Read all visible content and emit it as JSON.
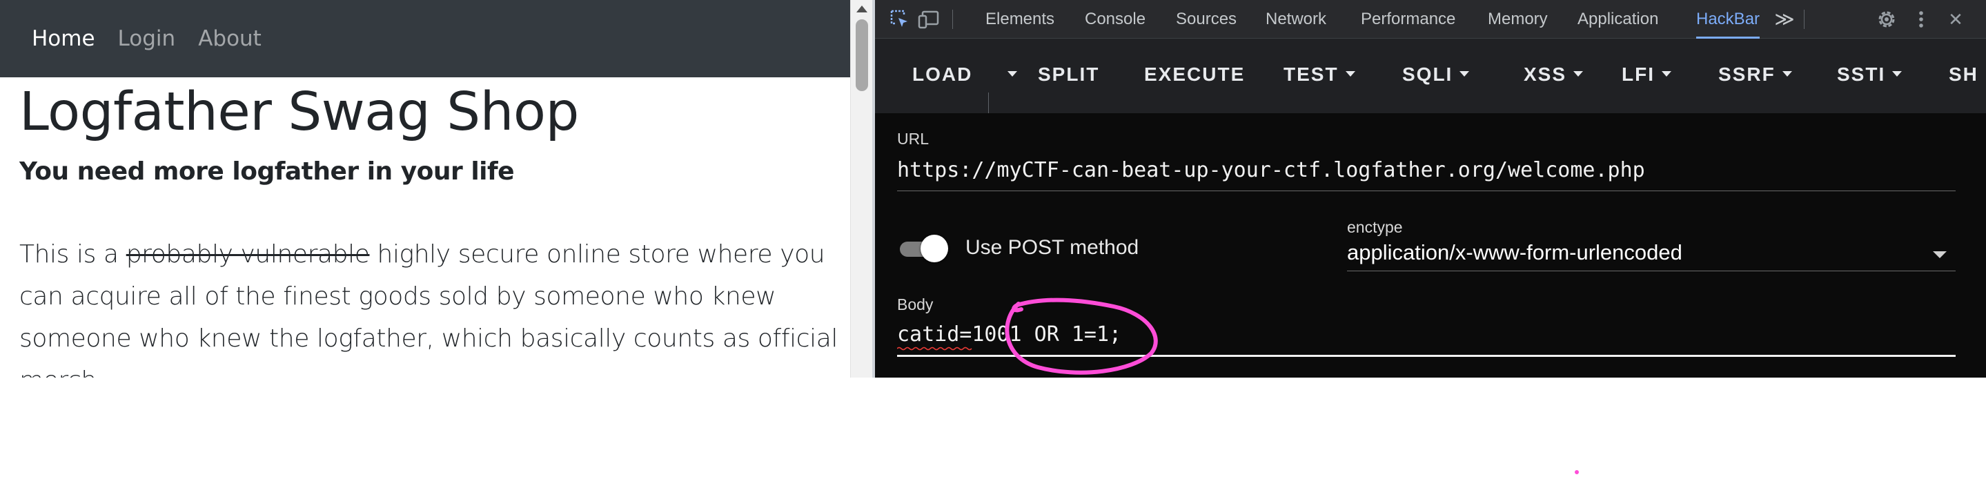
{
  "site": {
    "nav": {
      "home": "Home",
      "login": "Login",
      "about": "About"
    },
    "title": "Logfather Swag Shop",
    "subtitle": "You need more logfather in your life",
    "description": {
      "lead": "This is a",
      "struck": "probably vulnerable",
      "rest": "highly secure online store where you can acquire all of the finest goods sold by someone who knew someone who knew the logfather, which basically counts as official merch."
    }
  },
  "devtools": {
    "icons": [
      "inspect-element-icon",
      "device-toolbar-icon",
      "more-tabs-icon",
      "settings-icon",
      "kebab-menu-icon",
      "close-icon"
    ],
    "tabs": [
      "Elements",
      "Console",
      "Sources",
      "Network",
      "Performance",
      "Memory",
      "Application",
      "HackBar"
    ],
    "active_tab": "HackBar",
    "more_tabs_glyph": "≫",
    "close_glyph": "✕"
  },
  "hackbar": {
    "toolbar": {
      "load": "LOAD",
      "split": "SPLIT",
      "execute": "EXECUTE",
      "test": "TEST",
      "sqli": "SQLI",
      "xss": "XSS",
      "lfi": "LFI",
      "ssrf": "SSRF",
      "ssti": "SSTI",
      "sh": "SH"
    },
    "url_label": "URL",
    "url": "https://myCTF-can-beat-up-your-ctf.logfather.org/welcome.php",
    "post_label": "Use POST method",
    "post_enabled": true,
    "enctype_label": "enctype",
    "enctype": "application/x-www-form-urlencoded",
    "body_label": "Body",
    "body": "catid=1001 OR 1=1;"
  },
  "colors": {
    "navbar": "#343a40",
    "devtools_bg": "#202124",
    "form_bg": "#0b0b0b",
    "active_tab": "#7cacf8",
    "annotation": "#ff4dd8"
  }
}
